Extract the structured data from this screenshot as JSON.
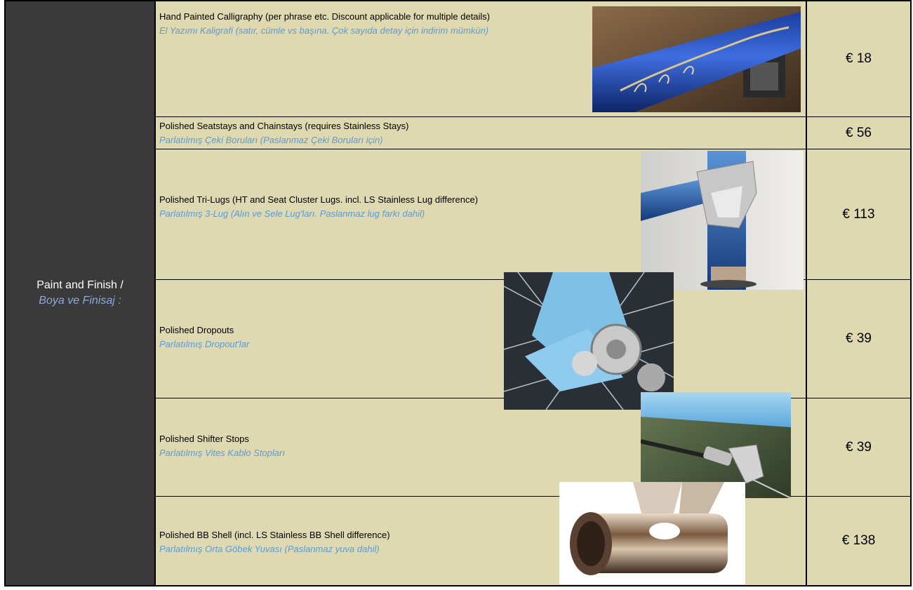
{
  "category": {
    "en": "Paint and Finish /",
    "tr": "Boya ve Finisaj :"
  },
  "rows": [
    {
      "en": "Hand Painted Calligraphy (per phrase etc. Discount applicable for multiple details)",
      "tr": "El Yazımı Kaligrafi (satır, cümle vs başına. Çok sayıda detay için indirim mümkün)",
      "price": "€ 18",
      "image_icon": "calligraphy-tube-photo"
    },
    {
      "en": "Polished Seatstays and Chainstays (requires Stainless Stays)",
      "tr": "Parlatılmış Çeki Boruları (Paslanmaz Çeki Boruları için)",
      "price": "€ 56"
    },
    {
      "en": "Polished Tri-Lugs (HT and Seat Cluster Lugs. incl. LS Stainless Lug difference)",
      "tr": "Parlatılmış 3-Lug (Alın ve Sele Lug'ları. Paslanmaz lug farkı dahil)",
      "price": "€ 113",
      "image_icon": "lug-photo"
    },
    {
      "en": "Polished Dropouts",
      "tr": "Parlatılmış Dropout'lar",
      "price": "€ 39",
      "image_icon": "dropout-photo"
    },
    {
      "en": "Polished Shifter Stops",
      "tr": "Parlatılmış Vites Kablo Stopları",
      "price": "€ 39",
      "image_icon": "shifter-stop-photo"
    },
    {
      "en": "Polished BB Shell (incl. LS Stainless BB Shell difference)",
      "tr": "Parlatılmış Orta Göbek Yuvası (Paslanmaz yuva dahil)",
      "price": "€ 138",
      "image_icon": "bb-shell-photo"
    }
  ],
  "colors": {
    "cell_bg": "#ded9b0",
    "category_bg": "#3a3a3a",
    "turkish_text": "#5b9bd5",
    "category_tr": "#8eaadb"
  }
}
